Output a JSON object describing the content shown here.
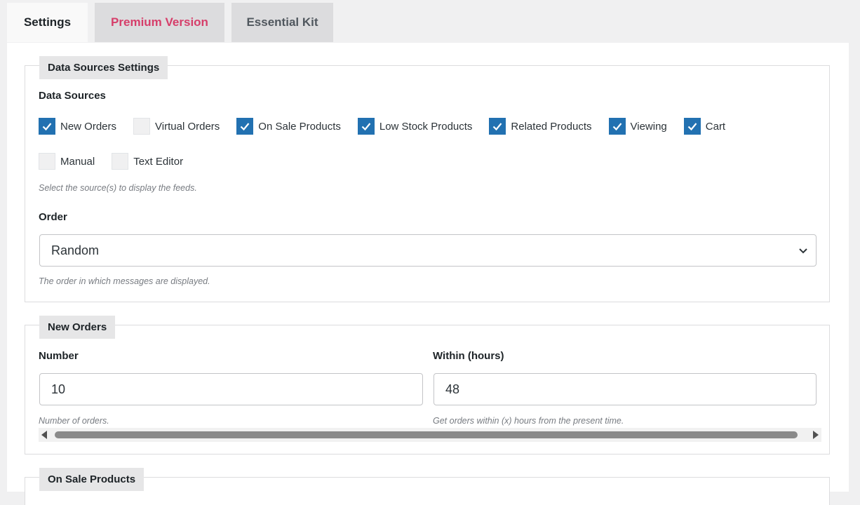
{
  "tabs": [
    {
      "label": "Settings",
      "active": true
    },
    {
      "label": "Premium Version",
      "color": "#d63e6a"
    },
    {
      "label": "Essential Kit"
    }
  ],
  "data_sources_settings": {
    "legend": "Data Sources Settings",
    "sources_label": "Data Sources",
    "sources": [
      {
        "label": "New Orders",
        "checked": true
      },
      {
        "label": "Virtual Orders",
        "checked": false
      },
      {
        "label": "On Sale Products",
        "checked": true
      },
      {
        "label": "Low Stock Products",
        "checked": true
      },
      {
        "label": "Related Products",
        "checked": true
      },
      {
        "label": "Viewing",
        "checked": true
      },
      {
        "label": "Cart",
        "checked": true
      },
      {
        "label": "Manual",
        "checked": false
      },
      {
        "label": "Text Editor",
        "checked": false
      }
    ],
    "sources_desc": "Select the source(s) to display the feeds.",
    "order_label": "Order",
    "order_value": "Random",
    "order_desc": "The order in which messages are displayed."
  },
  "new_orders": {
    "legend": "New Orders",
    "number_label": "Number",
    "number_value": "10",
    "number_desc": "Number of orders.",
    "within_label": "Within (hours)",
    "within_value": "48",
    "within_desc": "Get orders within (x) hours from the present time."
  },
  "on_sale_products": {
    "legend": "On Sale Products"
  },
  "colors": {
    "checkbox_checked": "#2271b1",
    "premium_tab": "#d63e6a"
  }
}
